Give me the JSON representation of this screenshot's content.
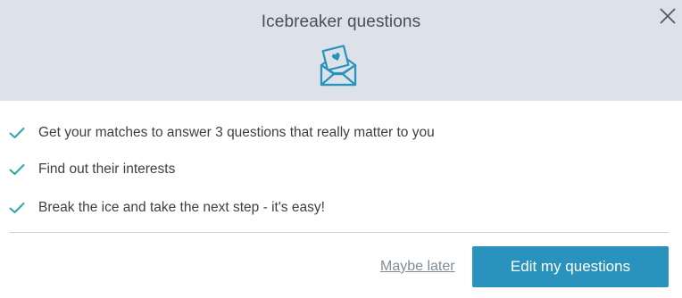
{
  "dialog": {
    "title": "Icebreaker questions",
    "close_icon": "close-icon",
    "header_icon": "envelope-heart-icon"
  },
  "benefits": [
    {
      "text": "Get your matches to answer 3 questions that really matter to you",
      "icon": "checkmark-icon"
    },
    {
      "text": "Find out their interests",
      "icon": "checkmark-icon"
    },
    {
      "text": "Break the ice and take the next step - it's easy!",
      "icon": "checkmark-icon"
    }
  ],
  "actions": {
    "secondary_label": "Maybe later",
    "primary_label": "Edit my questions"
  },
  "colors": {
    "header_bg": "#dde2ea",
    "accent": "#2a93bd",
    "check": "#2aa8a8"
  }
}
